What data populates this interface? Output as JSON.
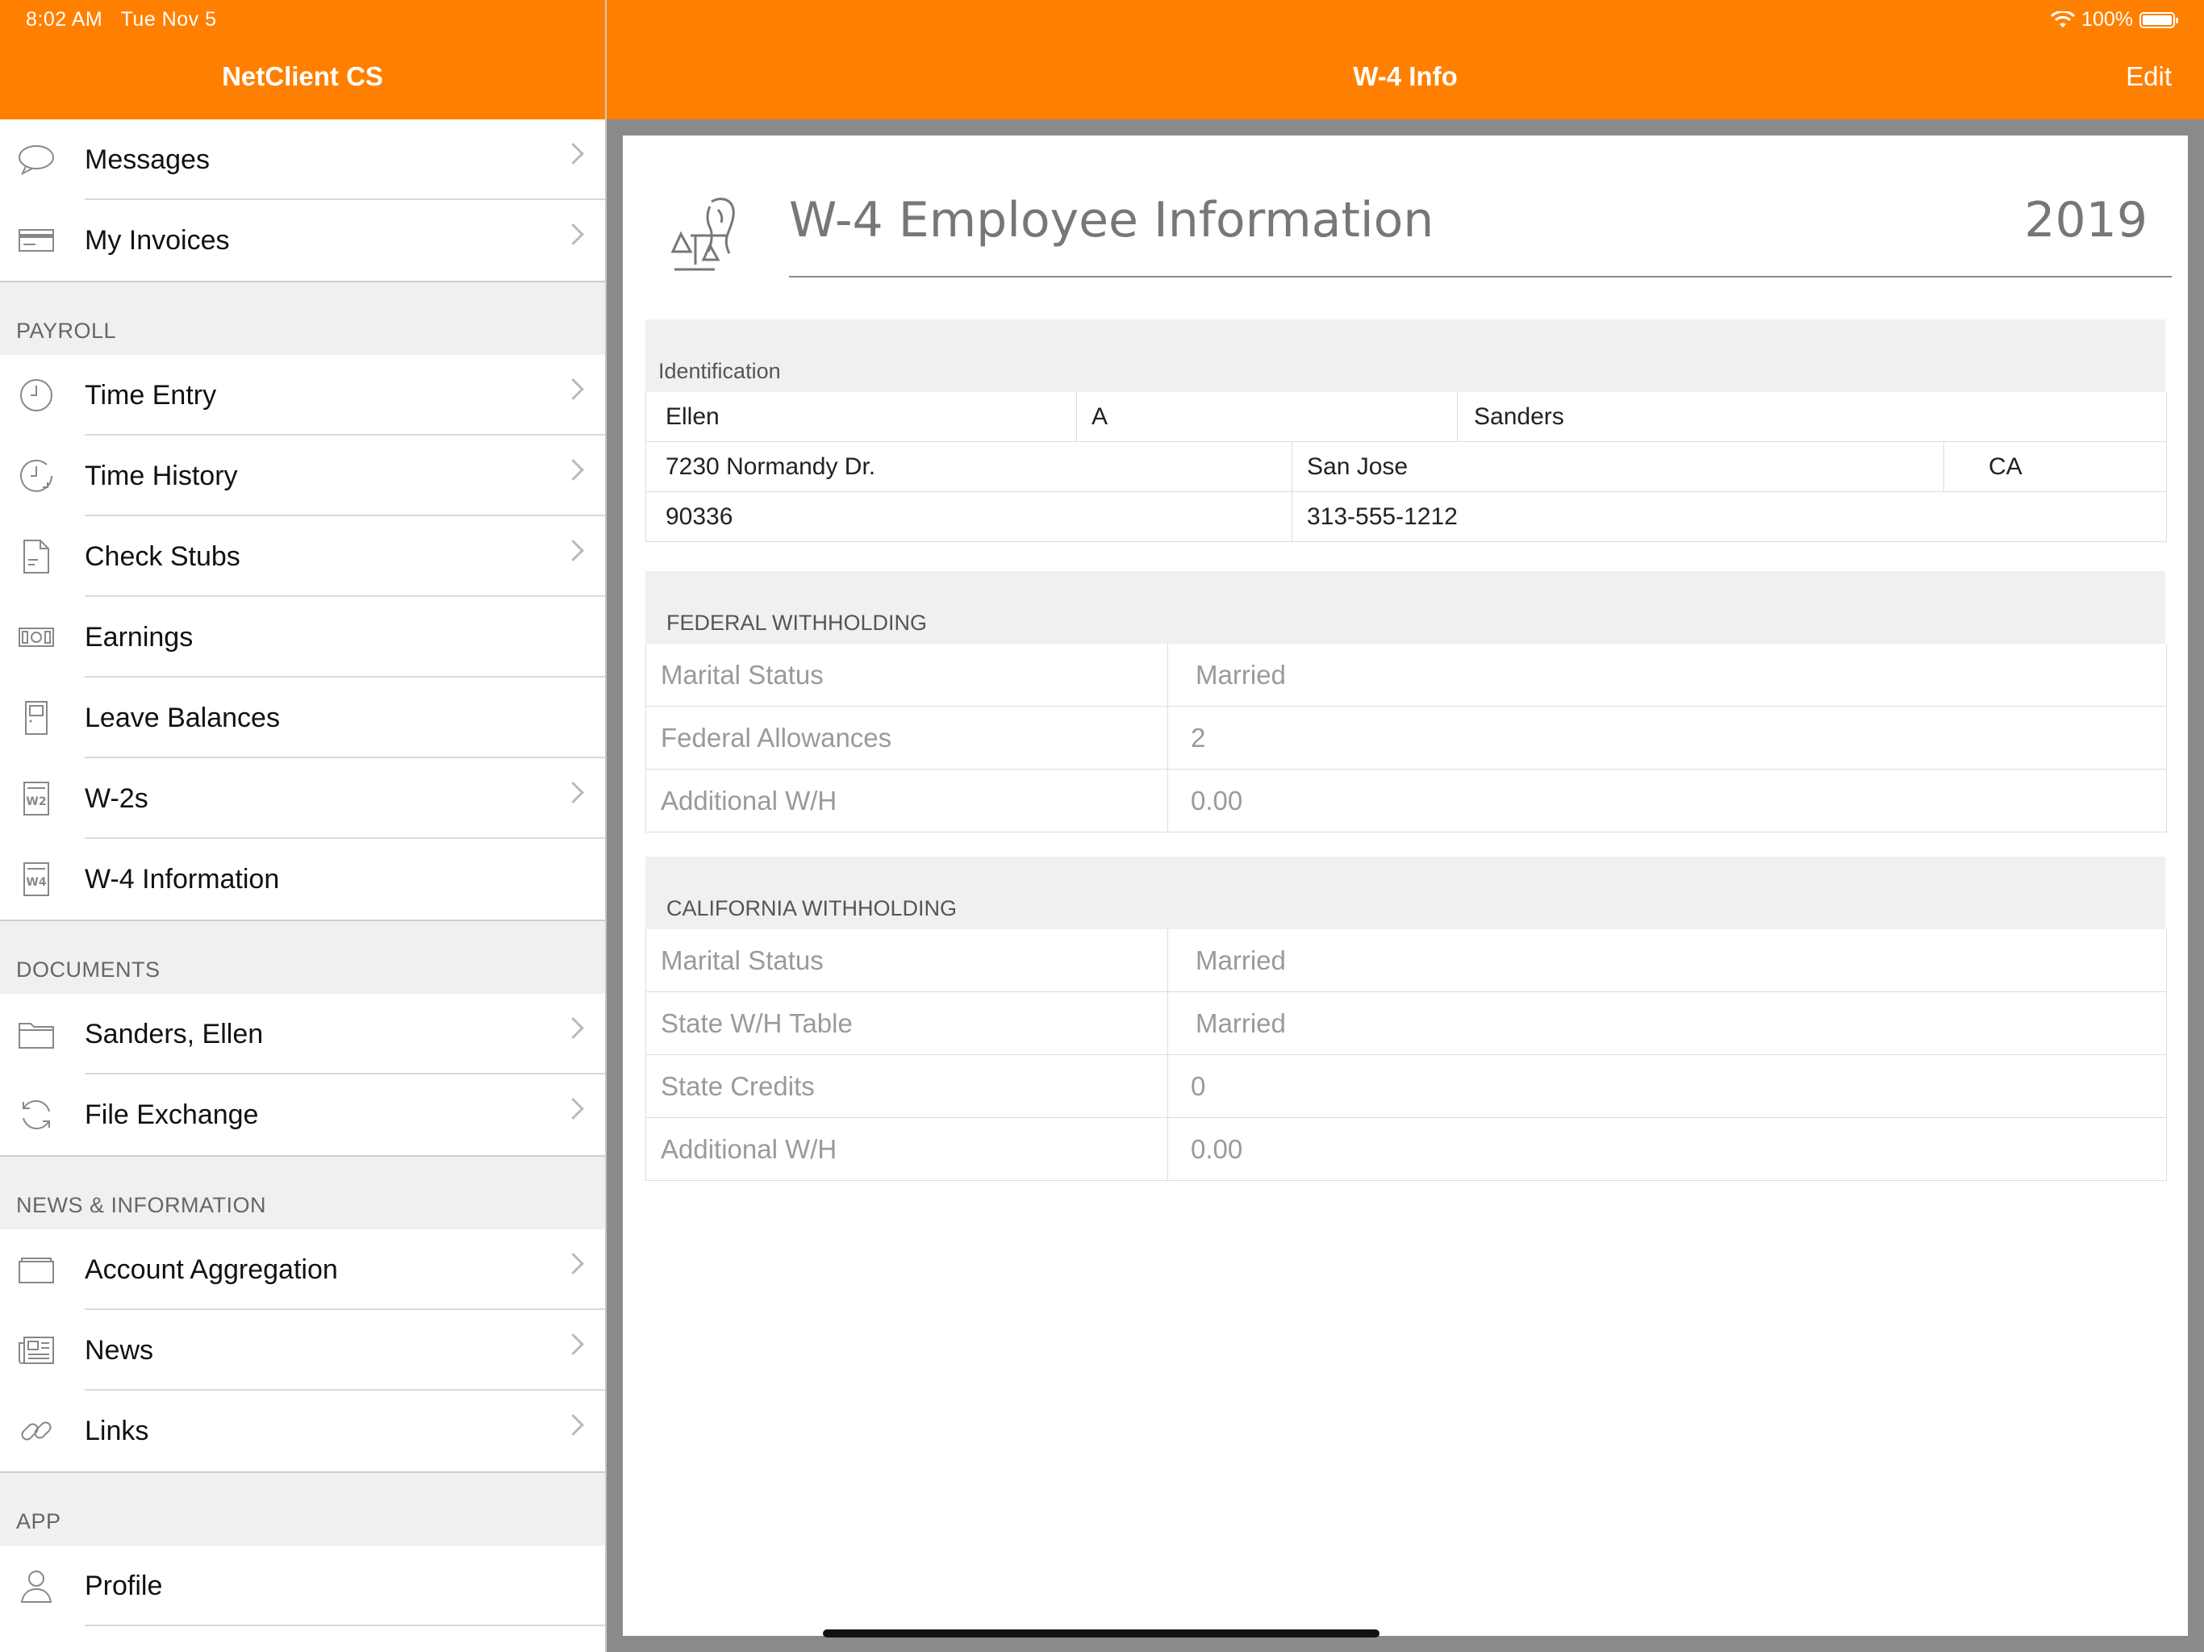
{
  "status_bar": {
    "time": "8:02 AM",
    "date": "Tue Nov 5",
    "battery": "100%"
  },
  "sidebar": {
    "title": "NetClient CS",
    "top_items": [
      {
        "label": "Messages",
        "icon": "speech-bubble-icon"
      },
      {
        "label": "My Invoices",
        "icon": "credit-card-icon"
      }
    ],
    "sections": [
      {
        "header": "PAYROLL",
        "items": [
          {
            "label": "Time Entry",
            "icon": "clock-icon"
          },
          {
            "label": "Time History",
            "icon": "clock-history-icon"
          },
          {
            "label": "Check Stubs",
            "icon": "document-icon"
          },
          {
            "label": "Earnings",
            "icon": "money-icon"
          },
          {
            "label": "Leave Balances",
            "icon": "door-icon"
          },
          {
            "label": "W-2s",
            "icon": "w2-form-icon"
          },
          {
            "label": "W-4 Information",
            "icon": "w4-form-icon"
          }
        ]
      },
      {
        "header": "DOCUMENTS",
        "items": [
          {
            "label": "Sanders, Ellen",
            "icon": "folder-icon"
          },
          {
            "label": "File Exchange",
            "icon": "sync-icon"
          }
        ]
      },
      {
        "header": "NEWS & INFORMATION",
        "items": [
          {
            "label": "Account Aggregation",
            "icon": "wallet-icon"
          },
          {
            "label": "News",
            "icon": "newspaper-icon"
          },
          {
            "label": "Links",
            "icon": "link-icon"
          }
        ]
      },
      {
        "header": "APP",
        "items": [
          {
            "label": "Profile",
            "icon": "person-icon"
          }
        ]
      }
    ]
  },
  "main": {
    "nav_title": "W-4 Info",
    "edit_label": "Edit",
    "doc_title": "W-4 Employee Information",
    "year": "2019",
    "identification": {
      "header": "Identification",
      "first_name": "Ellen",
      "middle_initial": "A",
      "last_name": "Sanders",
      "address": "7230 Normandy Dr.",
      "city": "San Jose",
      "state": "CA",
      "zip": "90336",
      "phone": "313-555-1212"
    },
    "federal": {
      "header": "FEDERAL WITHHOLDING",
      "rows": [
        {
          "label": "Marital Status",
          "value": "Married"
        },
        {
          "label": "Federal Allowances",
          "value": "2"
        },
        {
          "label": "Additional W/H",
          "value": "0.00"
        }
      ]
    },
    "california": {
      "header": "CALIFORNIA WITHHOLDING",
      "rows": [
        {
          "label": "Marital Status",
          "value": "Married"
        },
        {
          "label": "State W/H Table",
          "value": "Married"
        },
        {
          "label": "State Credits",
          "value": "0"
        },
        {
          "label": "Additional W/H",
          "value": "0.00"
        }
      ]
    }
  },
  "colors": {
    "accent": "#FF8000",
    "content_bg": "#8a8a8a"
  }
}
